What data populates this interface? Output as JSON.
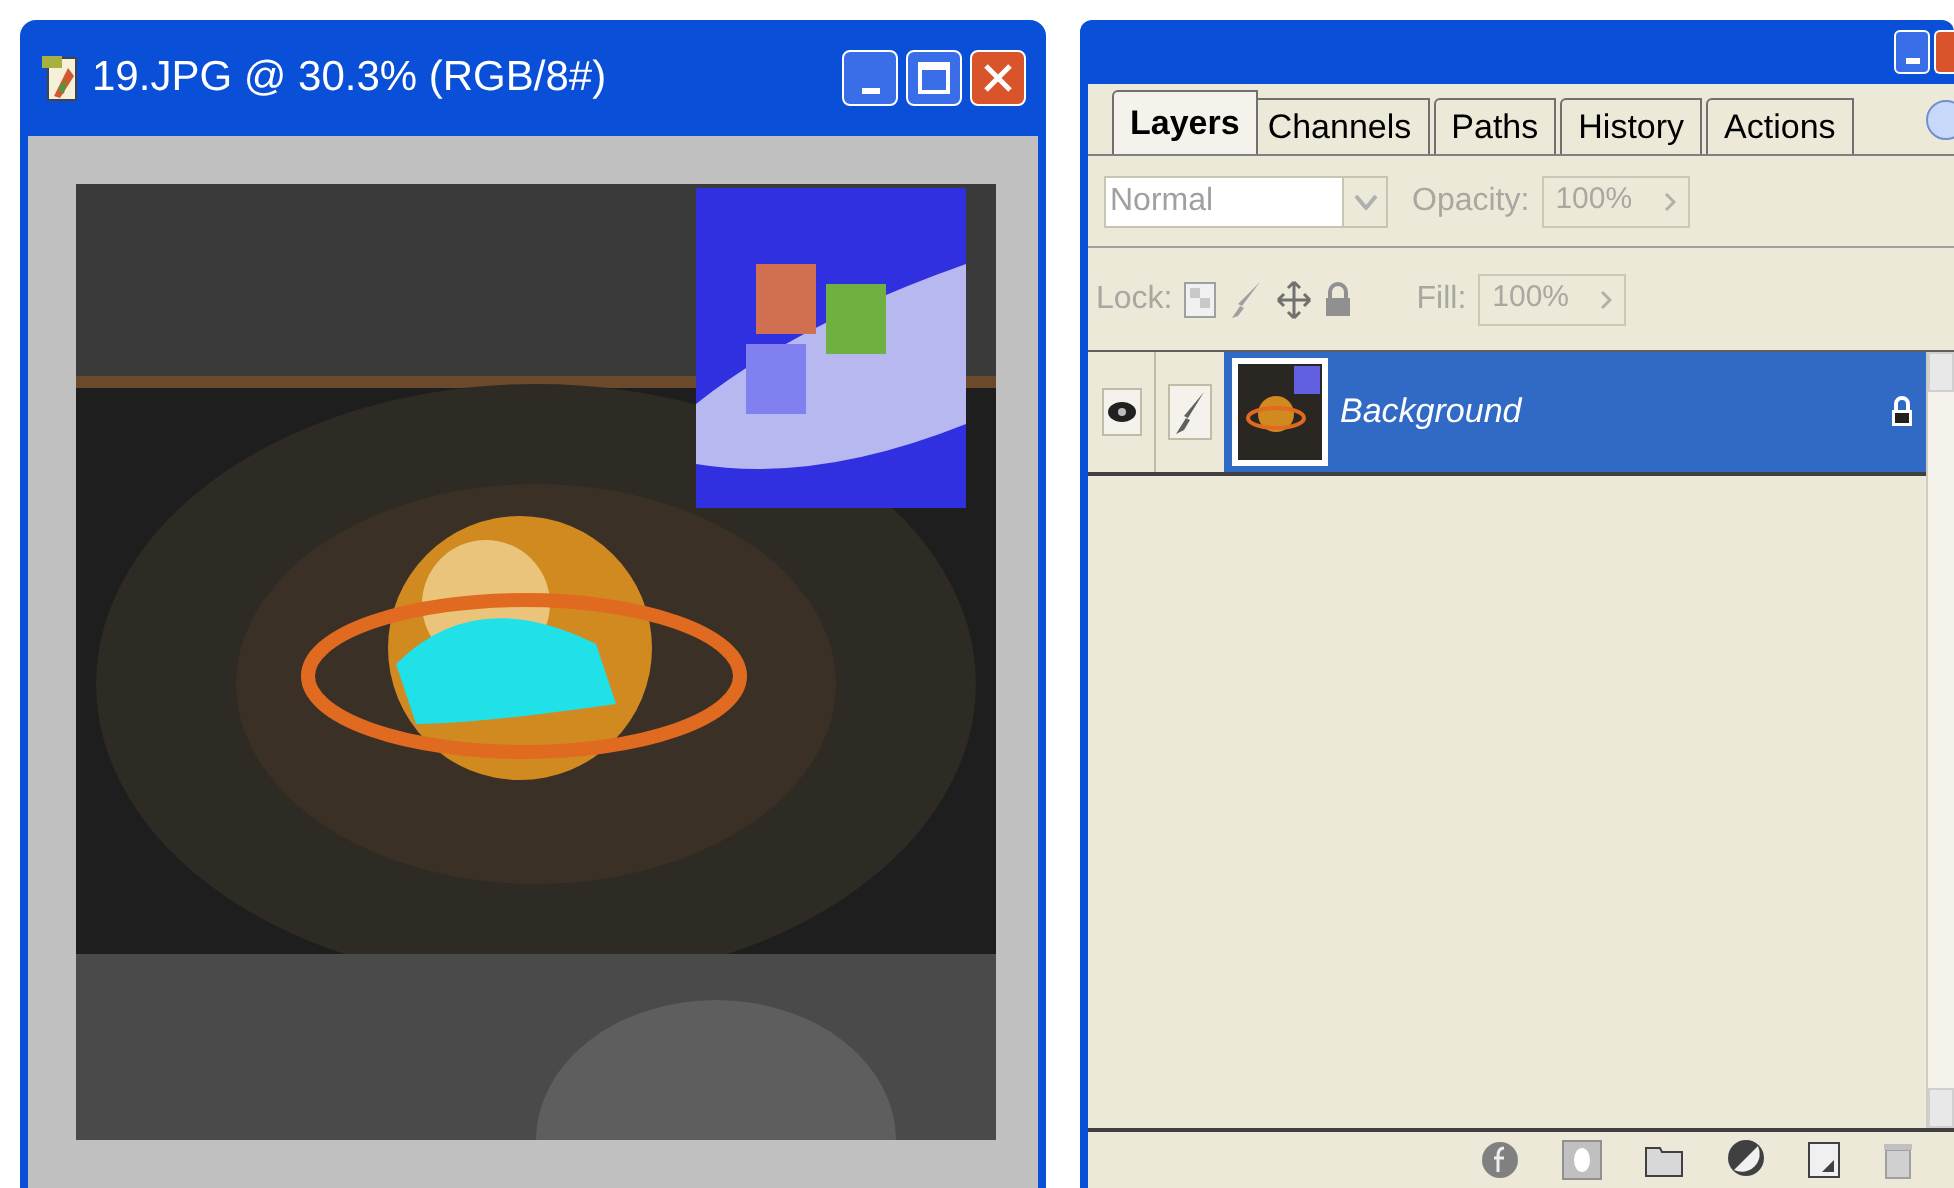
{
  "document_window": {
    "title": "19.JPG @ 30.3% (RGB/8#)"
  },
  "layers_panel": {
    "tabs": [
      {
        "label": "Layers",
        "selected": true
      },
      {
        "label": "Channels",
        "selected": false
      },
      {
        "label": "Paths",
        "selected": false
      },
      {
        "label": "History",
        "selected": false
      },
      {
        "label": "Actions",
        "selected": false
      }
    ],
    "blend_mode": "Normal",
    "opacity_label": "Opacity:",
    "opacity": "100%",
    "lock_label": "Lock:",
    "fill_label": "Fill:",
    "fill": "100%",
    "layers": [
      {
        "name": "Background",
        "selected": true,
        "visible": true,
        "locked": true
      }
    ]
  }
}
